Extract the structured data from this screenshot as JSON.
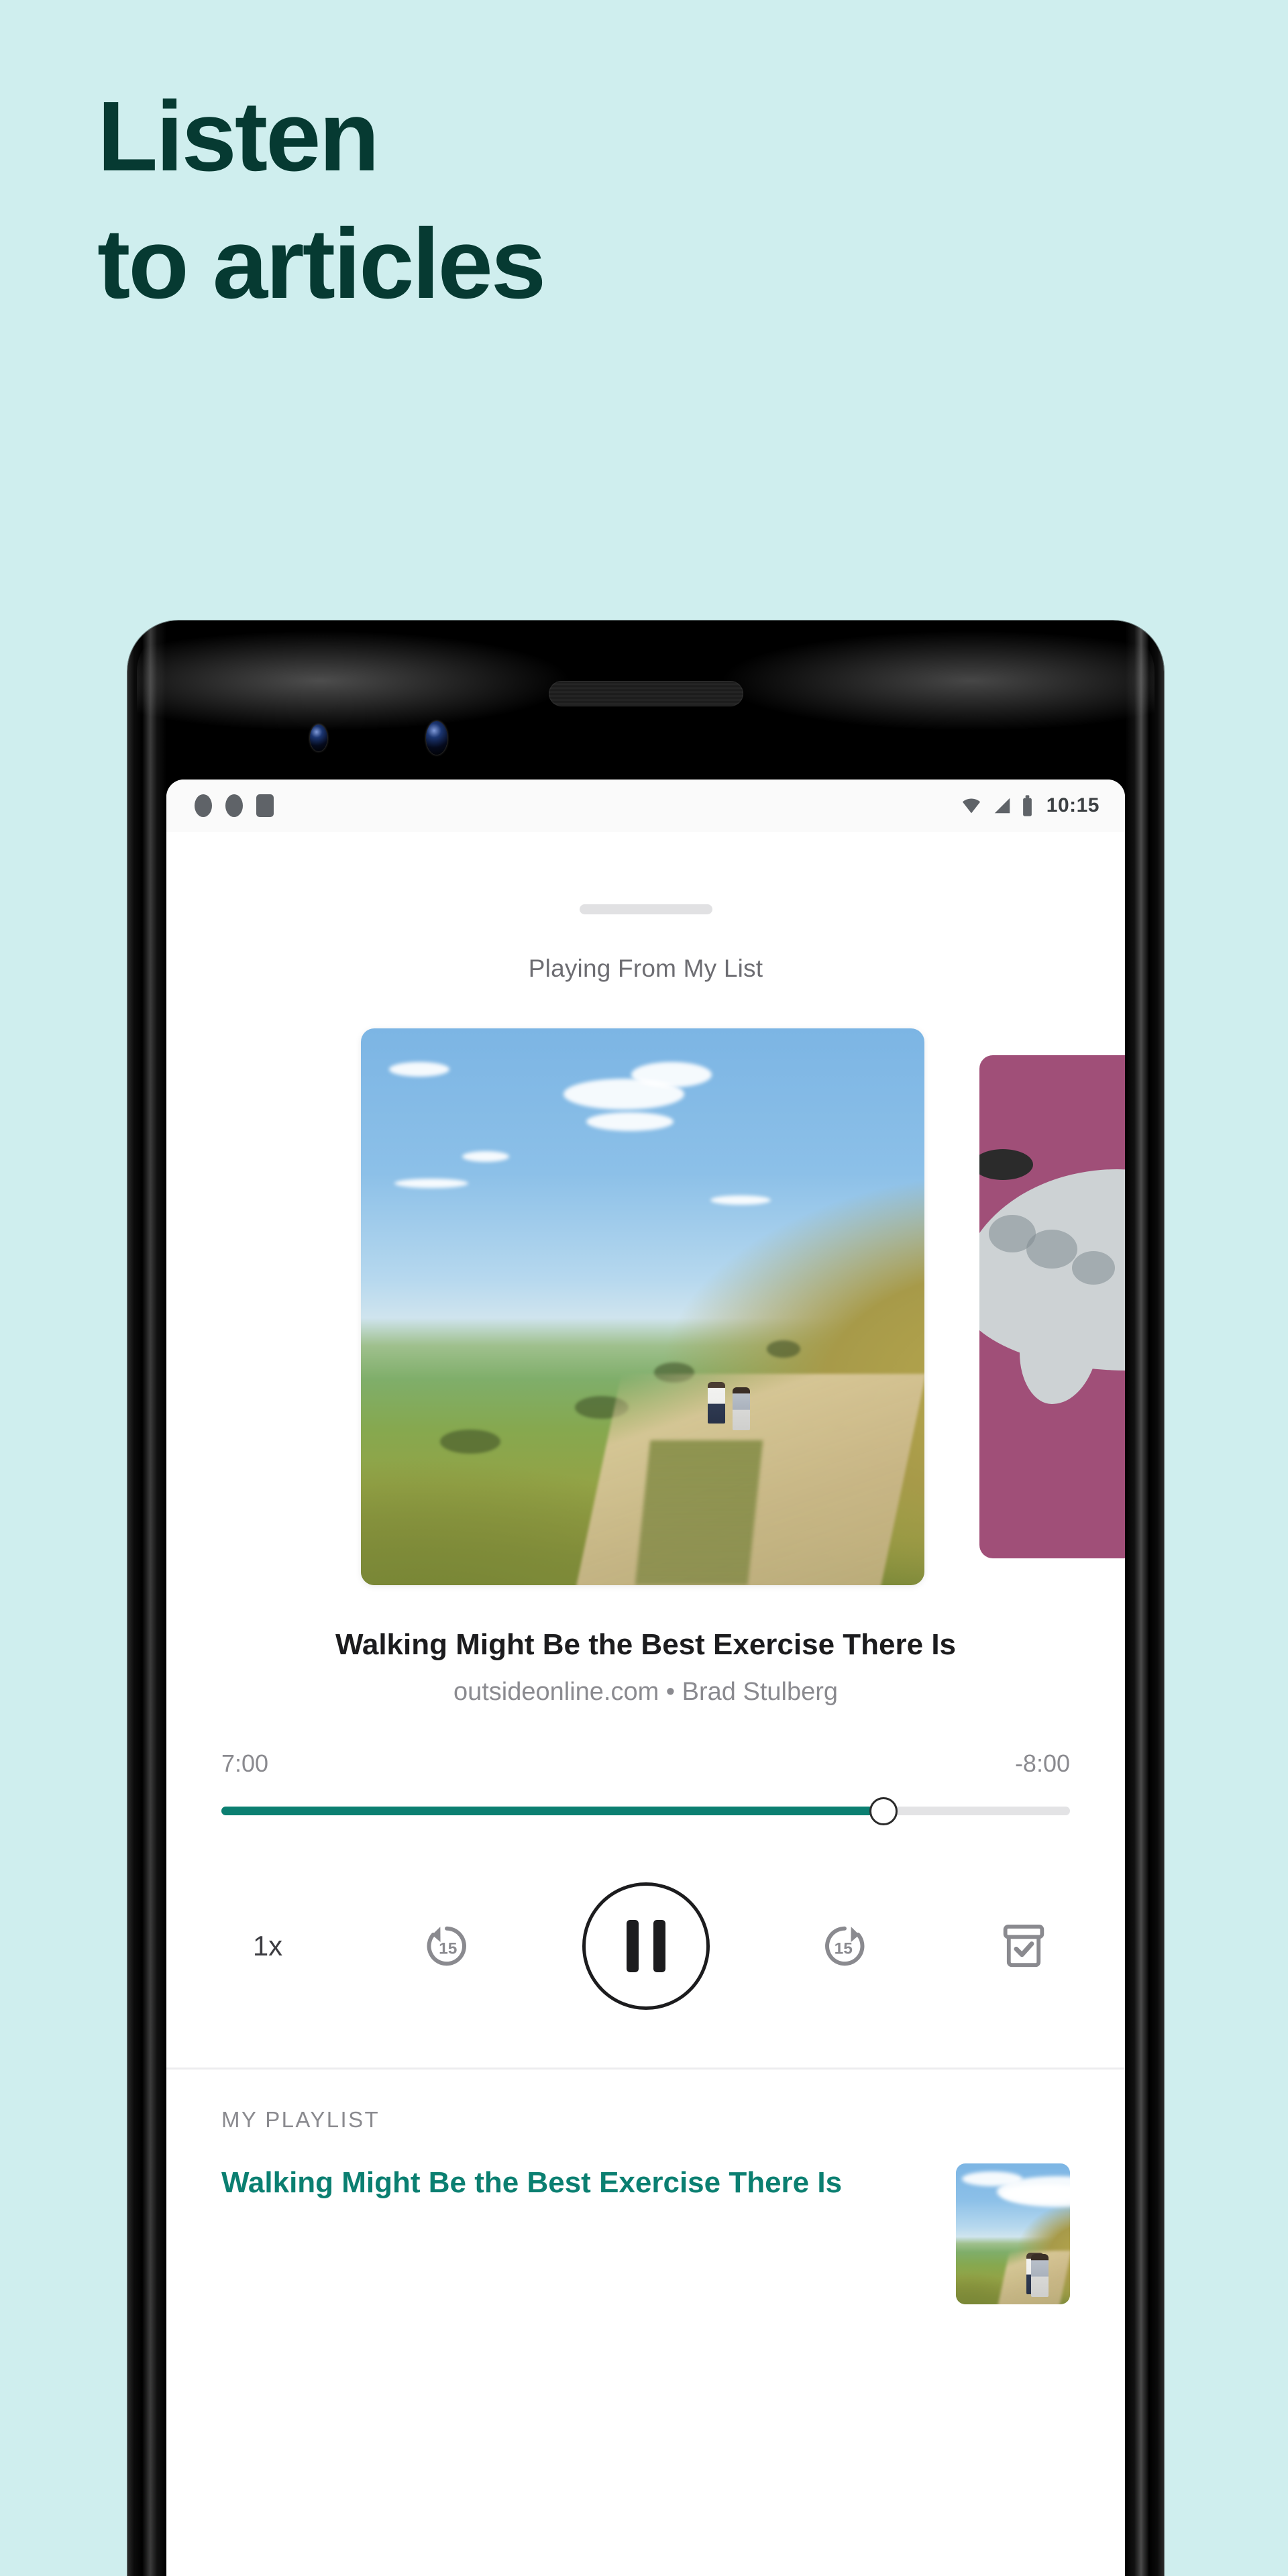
{
  "promo": {
    "headline_line1": "Listen",
    "headline_line2": "to articles",
    "headline_color": "#063a32",
    "background_color": "#cfeeee"
  },
  "phone": {
    "status_bar": {
      "time": "10:15",
      "icons": [
        "notification-dot",
        "notification-dot",
        "notification-square",
        "wifi-icon",
        "signal-icon",
        "battery-icon"
      ]
    }
  },
  "player": {
    "source_label": "Playing From My List",
    "track_title": "Walking Might Be the Best Exercise There Is",
    "track_meta": "outsideonline.com • Brad Stulberg",
    "elapsed_time": "7:00",
    "remaining_time": "-8:00",
    "progress_percent": 78,
    "accent_color": "#0b7f71",
    "controls": {
      "speed_label": "1x",
      "rewind_label": "15",
      "forward_label": "15",
      "play_state": "pause",
      "archive_label": "archive"
    }
  },
  "playlist": {
    "section_header": "MY PLAYLIST",
    "items": [
      {
        "title": "Walking Might Be the Best Exercise There Is"
      }
    ]
  }
}
